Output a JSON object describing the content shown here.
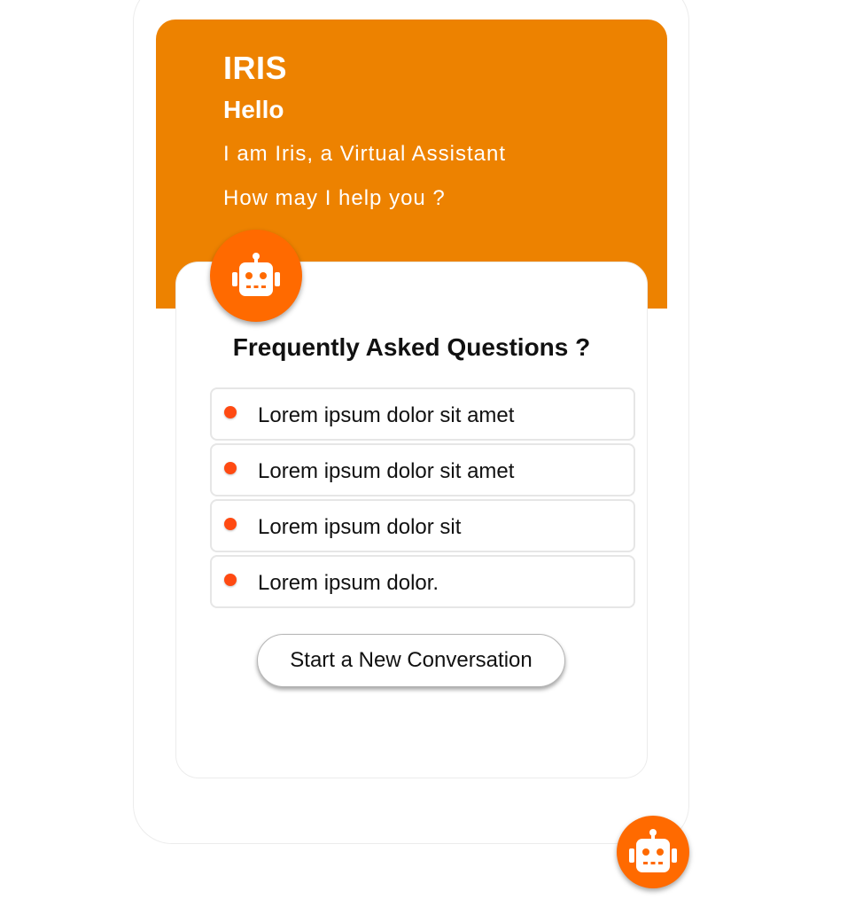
{
  "header": {
    "title": "IRIS",
    "greeting": "Hello",
    "intro": "I am Iris, a Virtual Assistant",
    "prompt": "How may I help you ?"
  },
  "faq": {
    "title": "Frequently Asked Questions ?",
    "items": [
      {
        "label": "Lorem ipsum dolor sit amet"
      },
      {
        "label": "Lorem ipsum dolor sit amet"
      },
      {
        "label": "Lorem ipsum dolor sit"
      },
      {
        "label": "Lorem ipsum dolor."
      }
    ]
  },
  "actions": {
    "new_conversation_label": "Start a New Conversation"
  },
  "icons": {
    "avatar": "robot-icon",
    "launcher": "robot-icon"
  },
  "colors": {
    "header_bg": "#ed8200",
    "accent": "#ff6a00",
    "bullet": "#ff4a12"
  }
}
